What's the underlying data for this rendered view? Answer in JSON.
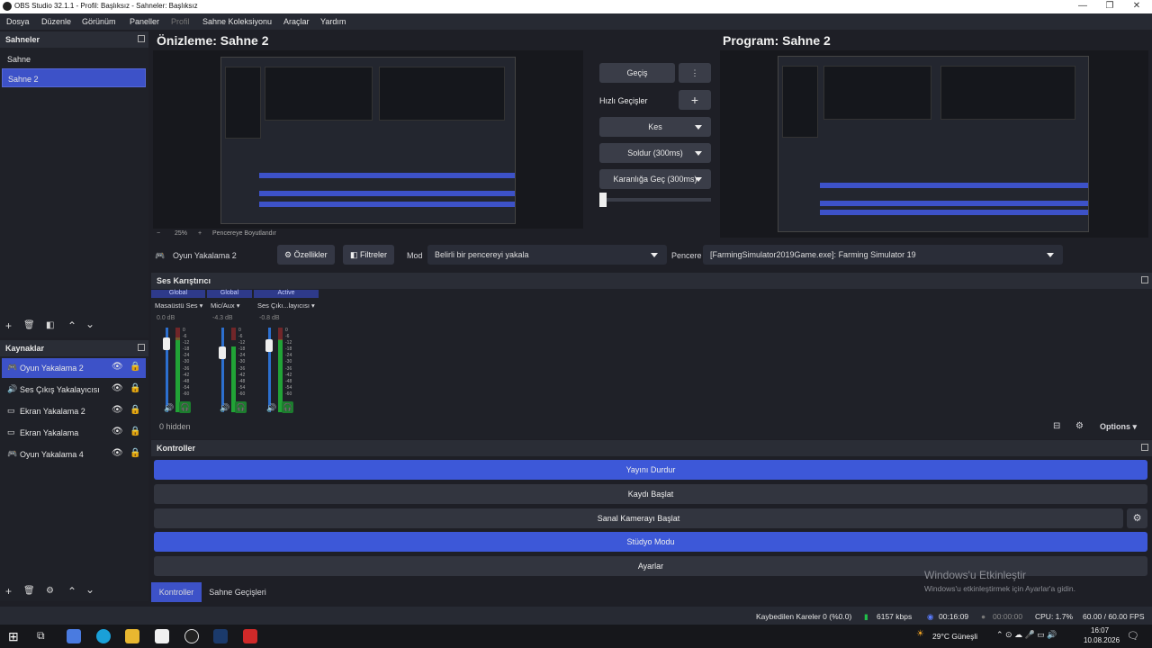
{
  "window": {
    "title": "OBS Studio 32.1.1 - Profil: Başlıksız - Sahneler: Başlıksız"
  },
  "menu": [
    "Dosya",
    "Düzenle",
    "Görünüm",
    "Paneller",
    "Profil",
    "Sahne Koleksiyonu",
    "Araçlar",
    "Yardım"
  ],
  "scenes": {
    "title": "Sahneler",
    "items": [
      "Sahne",
      "Sahne 2"
    ],
    "selected": 1
  },
  "sources": {
    "title": "Kaynaklar",
    "items": [
      {
        "label": "Oyun Yakalama 2",
        "icon": "gamepad-icon"
      },
      {
        "label": "Ses Çıkış Yakalayıcısı",
        "icon": "speaker-icon"
      },
      {
        "label": "Ekran Yakalama 2",
        "icon": "monitor-icon"
      },
      {
        "label": "Ekran Yakalama",
        "icon": "monitor-icon"
      },
      {
        "label": "Oyun Yakalama 4",
        "icon": "gamepad-icon"
      }
    ]
  },
  "preview": {
    "title": "Önizleme: Sahne 2",
    "zoom": "25%",
    "scale_mode": "Pencereye Boyutlandır"
  },
  "program": {
    "title": "Program: Sahne 2"
  },
  "transitions": {
    "main": "Geçiş",
    "quick_label": "Hızlı Geçişler",
    "items": [
      "Kes",
      "Soldur (300ms)",
      "Karanlığa Geç (300ms)"
    ]
  },
  "source_bar": {
    "name": "Oyun Yakalama 2",
    "properties": "Özellikler",
    "filters": "Filtreler",
    "mode_label": "Mod",
    "mode_value": "Belirli bir pencereyi yakala",
    "window_label": "Pencere",
    "window_value": "[FarmingSimulator2019Game.exe]: Farming Simulator 19"
  },
  "mixer": {
    "title": "Ses Karıştırıcı",
    "hidden": "0 hidden",
    "options": "Options",
    "channels": [
      {
        "tag": "Global",
        "name": "Masaüstü Ses",
        "db": "0.0 dB",
        "level": 0.88
      },
      {
        "tag": "Global",
        "name": "Mic/Aux",
        "db": "-4.3 dB",
        "level": 0.78
      },
      {
        "tag": "Active",
        "name": "Ses Çıkı...layıcısı",
        "db": "-0.8 dB",
        "level": 0.86
      }
    ],
    "scale": [
      "0",
      "-6",
      "-12",
      "-18",
      "-24",
      "-30",
      "-36",
      "-42",
      "-48",
      "-54",
      "-60"
    ]
  },
  "controls": {
    "title": "Kontroller",
    "buttons": [
      "Yayını Durdur",
      "Kaydı Başlat",
      "Sanal Kamerayı Başlat",
      "Stüdyo Modu",
      "Ayarlar"
    ],
    "tabs": [
      "Kontroller",
      "Sahne Geçişleri"
    ]
  },
  "watermark": {
    "line1": "Windows'u Etkinleştir",
    "line2": "Windows'u etkinleştirmek için Ayarlar'a gidin."
  },
  "status": {
    "dropped": "Kaybedilen Kareler 0 (%0.0)",
    "bitrate": "6157 kbps",
    "stream_time": "00:16:09",
    "rec_time": "00:00:00",
    "cpu": "CPU: 1.7%",
    "fps": "60.00 / 60.00 FPS"
  },
  "taskbar": {
    "weather": "29°C Güneşli",
    "time": "16:07",
    "date": "10.08.2026"
  }
}
